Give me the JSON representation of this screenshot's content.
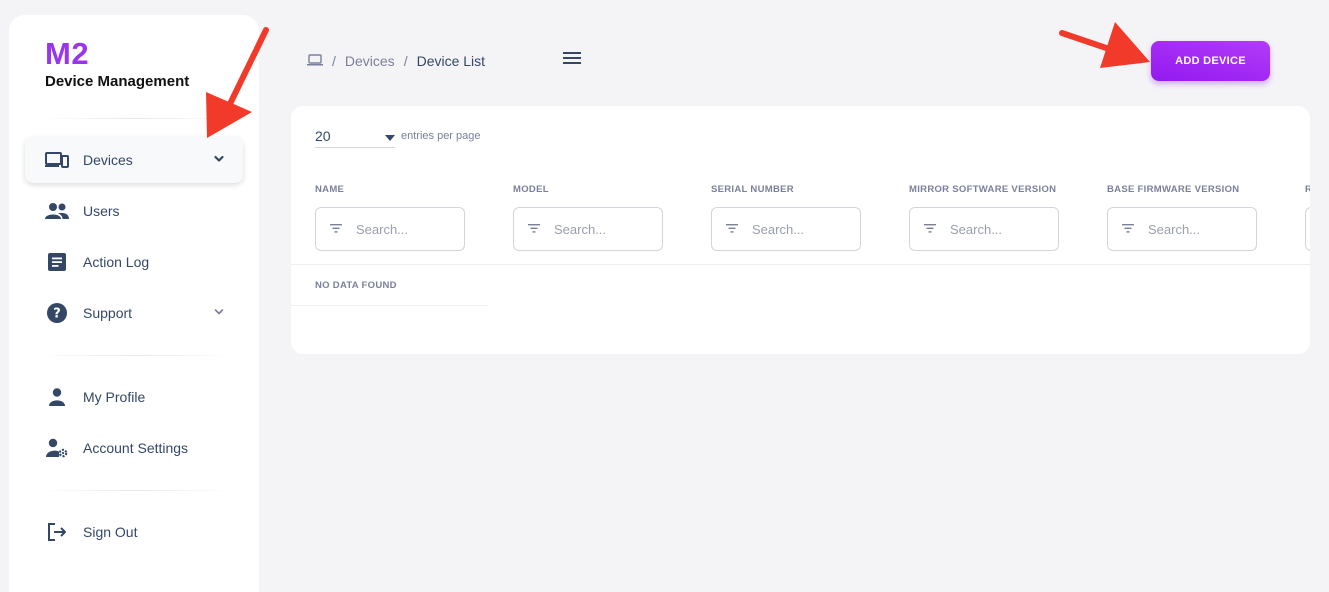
{
  "sidebar": {
    "brand_title": "M2",
    "brand_subtitle": "Device Management",
    "items": [
      {
        "label": "Devices",
        "icon": "devices-icon",
        "active": true,
        "has_chevron": true
      },
      {
        "label": "Users",
        "icon": "users-icon"
      },
      {
        "label": "Action Log",
        "icon": "document-icon"
      },
      {
        "label": "Support",
        "icon": "help-circle-icon",
        "has_chevron": true
      },
      {
        "label": "My Profile",
        "icon": "person-icon"
      },
      {
        "label": "Account Settings",
        "icon": "user-gear-icon"
      },
      {
        "label": "Sign Out",
        "icon": "logout-icon"
      }
    ]
  },
  "header": {
    "breadcrumb": {
      "home_icon": "laptop-icon",
      "separator": "/",
      "parent": "Devices",
      "current": "Device List"
    },
    "menu_icon": "hamburger-icon",
    "add_button_label": "ADD DEVICE"
  },
  "table": {
    "entries_value": "20",
    "entries_label": "entries per page",
    "columns": [
      {
        "header": "NAME",
        "placeholder": "Search..."
      },
      {
        "header": "MODEL",
        "placeholder": "Search..."
      },
      {
        "header": "SERIAL NUMBER",
        "placeholder": "Search..."
      },
      {
        "header": "MIRROR SOFTWARE VERSION",
        "placeholder": "Search..."
      },
      {
        "header": "BASE FIRMWARE VERSION",
        "placeholder": "Search..."
      },
      {
        "header": "R",
        "placeholder": ""
      }
    ],
    "empty_message": "NO DATA FOUND"
  },
  "colors": {
    "brand": "#9b34ef",
    "button": "#9a22f2",
    "annotation_arrow": "#f23a2a",
    "text": "#344767",
    "muted": "#7b809a"
  }
}
